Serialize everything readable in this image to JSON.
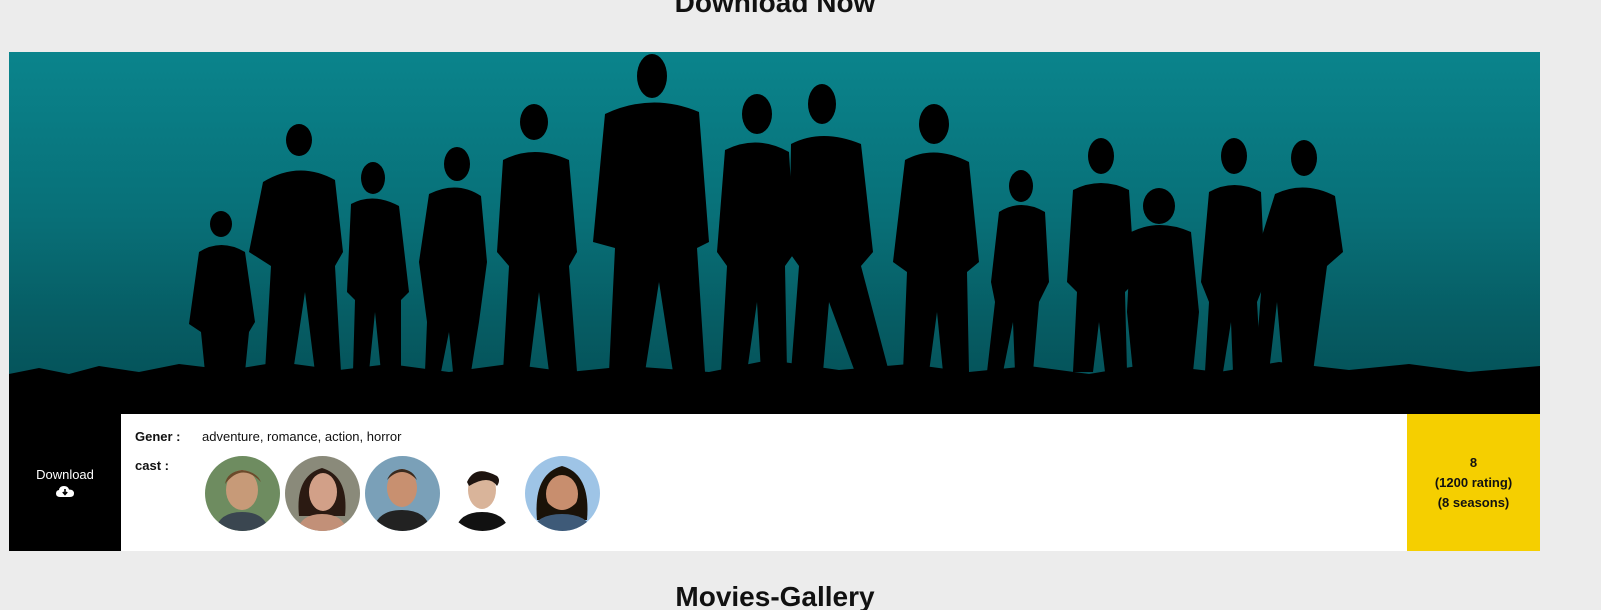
{
  "sections": {
    "top_title": "Download Now",
    "bottom_title": "Movies-Gallery"
  },
  "show": {
    "download_label": "Download",
    "download_icon": "cloud-download-icon",
    "gener_label": "Gener :",
    "genres": "adventure, romance, action, horror",
    "cast_label": "cast :",
    "cast": [
      {
        "name": "cast-member-1",
        "bg": "#6e8c60",
        "skin": "#c79a78",
        "hair": "#6b4a2b"
      },
      {
        "name": "cast-member-2",
        "bg": "#8a8a7a",
        "skin": "#d2a088",
        "hair": "#2b1a12"
      },
      {
        "name": "cast-member-3",
        "bg": "#7aa0b8",
        "skin": "#c89070",
        "hair": "#3a2a1e"
      },
      {
        "name": "cast-member-4",
        "bg": "#ffffff",
        "skin": "#d9b49a",
        "hair": "#1e1410"
      },
      {
        "name": "cast-member-5",
        "bg": "#9ec4e6",
        "skin": "#c88e6e",
        "hair": "#1a1208"
      }
    ],
    "rating_value": "8",
    "rating_count": "(1200 rating)",
    "seasons": "(8 seasons)"
  },
  "colors": {
    "hero_top": "#0a848c",
    "hero_bottom": "#044e55",
    "rating_bg": "#f5cf00",
    "download_bg": "#000000"
  }
}
